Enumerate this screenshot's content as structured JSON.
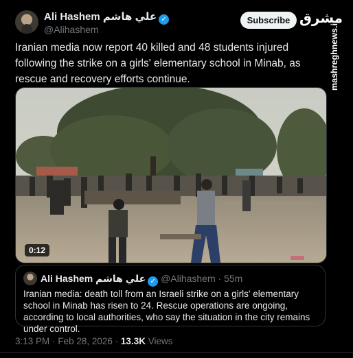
{
  "author": {
    "name": "Ali Hashem",
    "name_ar": "علي هاشم",
    "handle": "@Alihashem"
  },
  "subscribe_label": "Subscribe",
  "more_icon": "more-icon",
  "logo": {
    "text": "مشرق",
    "url_text": "mashreghnews.ir"
  },
  "tweet": {
    "text": "Iranian media now report 40 killed and 48 students injured following the strike on a girls' elementary school in Minab, as rescue and recovery efforts continue."
  },
  "video": {
    "duration": "0:12"
  },
  "quote": {
    "name": "Ali Hashem",
    "name_ar": "علي هاشم",
    "handle": "@Alihashem",
    "time": "55m",
    "text": "Iranian media: death toll from an Israeli strike on a girls' elementary school in Minab has risen to 24. Rescue operations are ongoing, according to local authorities, who say the situation in the city remains under control."
  },
  "footer": {
    "time": "3:13 PM",
    "date": "Feb 28, 2026",
    "views_count": "13.3K",
    "views_label": "Views"
  },
  "colors": {
    "background": "#000000",
    "text": "#e7e9ea",
    "muted": "#71767b",
    "verified": "#1d9bf0"
  }
}
